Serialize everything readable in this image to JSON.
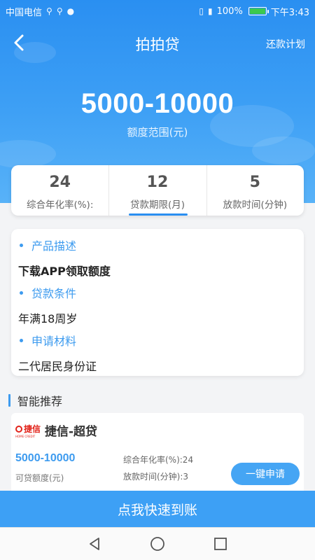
{
  "status_bar": {
    "carrier": "中国电信",
    "battery_percent": "100%",
    "battery_level": 1.0,
    "time": "下午3:43",
    "icons": [
      "usb-icon",
      "usb-icon",
      "message-icon",
      "vibrate-icon",
      "signal-icon"
    ]
  },
  "header": {
    "title": "拍拍贷",
    "right_action": "还款计划",
    "back_icon": "chevron-left-icon"
  },
  "hero": {
    "amount": "5000-10000",
    "amount_label": "额度范围(元)"
  },
  "stats": [
    {
      "value": "24",
      "label": "综合年化率(%):"
    },
    {
      "value": "12",
      "label": "贷款期限(月)"
    },
    {
      "value": "5",
      "label": "放款时间(分钟)"
    }
  ],
  "info": {
    "sections": [
      {
        "title": "产品描述",
        "body": "下载APP领取额度"
      },
      {
        "title": "贷款条件",
        "body": "年满18周岁"
      },
      {
        "title": "申请材料",
        "body": "二代居民身份证"
      }
    ]
  },
  "recommend": {
    "title": "智能推荐",
    "item": {
      "logo_text": "捷信",
      "logo_sub": "HOME CREDIT",
      "name": "捷信-超贷",
      "amount": "5000-10000",
      "amount_label": "可贷额度(元)",
      "rate": "综合年化率(%):24",
      "time": "放款时间(分钟):3",
      "apply_label": "一键申请"
    }
  },
  "cta_label": "点我快速到账",
  "colors": {
    "primary": "#2a8ff1",
    "accent": "#3d9bef",
    "button": "#45a5f4",
    "logo_red": "#e2231a"
  }
}
